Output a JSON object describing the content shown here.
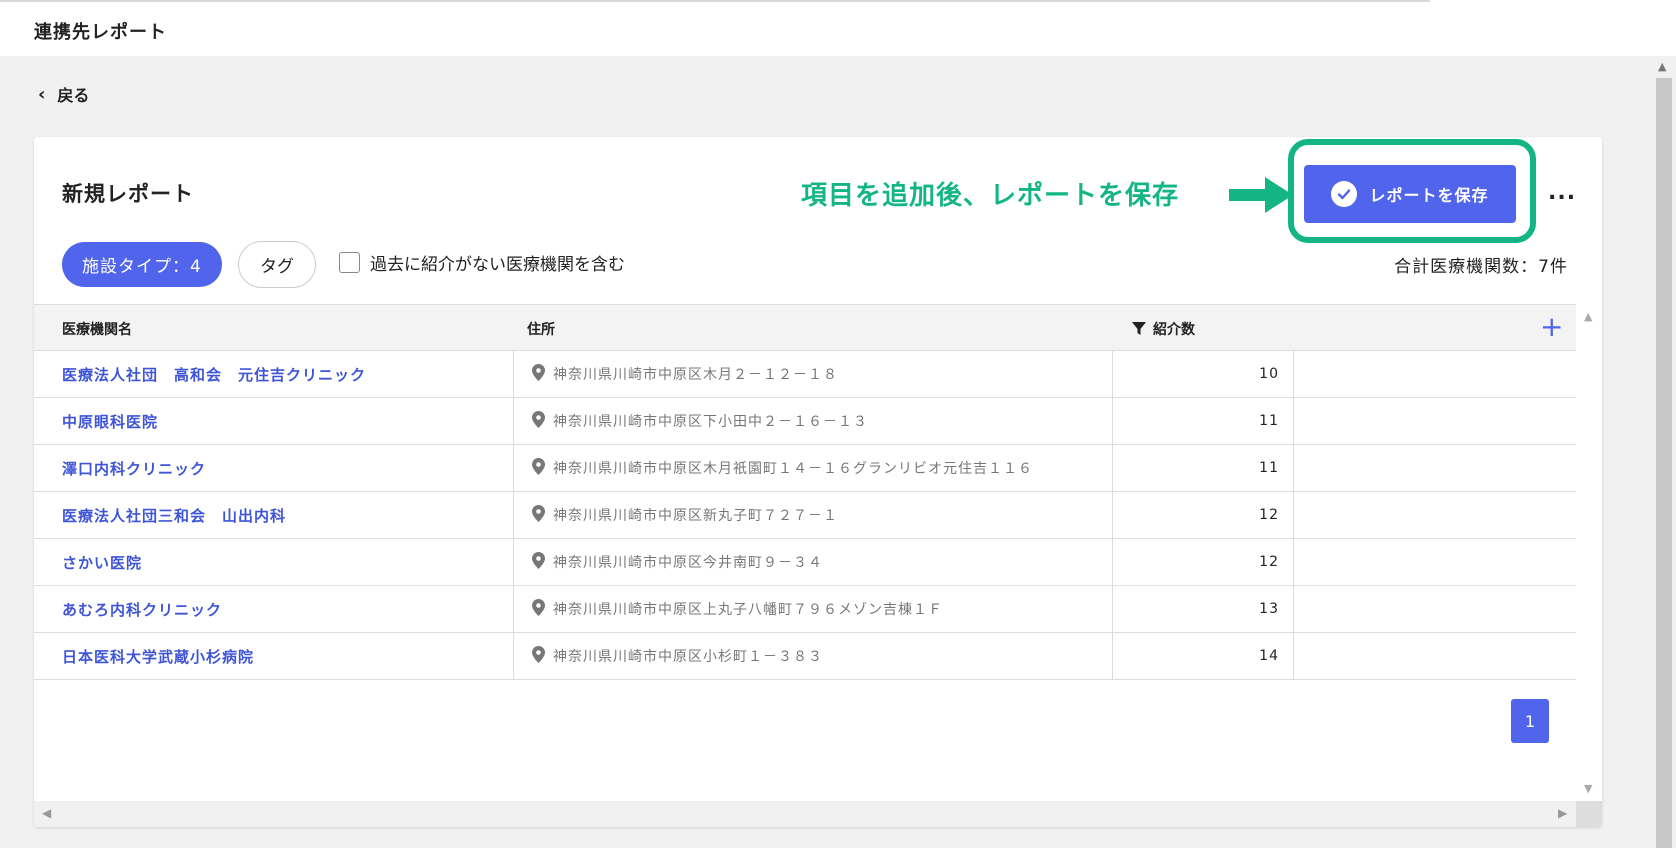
{
  "header": {
    "title": "連携先レポート"
  },
  "nav": {
    "back_label": "戻る"
  },
  "report": {
    "title": "新規レポート",
    "annotation": "項目を追加後、レポートを保存",
    "save_button": "レポートを保存",
    "more_label": "...",
    "filters": {
      "facility_type_chip": "施設タイプ：4",
      "tag_chip": "タグ",
      "include_checkbox_label": "過去に紹介がない医療機関を含む",
      "include_checked": false
    },
    "total_label": "合計医療機関数：7件"
  },
  "table": {
    "columns": {
      "name": "医療機関名",
      "address": "住所",
      "referrals": "紹介数",
      "add": "+"
    },
    "rows": [
      {
        "name": "医療法人社団　高和会　元住吉クリニック",
        "address": "神奈川県川崎市中原区木月２－１２－１８",
        "referrals": "10"
      },
      {
        "name": "中原眼科医院",
        "address": "神奈川県川崎市中原区下小田中２－１６－１３",
        "referrals": "11"
      },
      {
        "name": "澤口内科クリニック",
        "address": "神奈川県川崎市中原区木月祇園町１４－１６グランリビオ元住吉１１６",
        "referrals": "11"
      },
      {
        "name": "医療法人社団三和会　山出内科",
        "address": "神奈川県川崎市中原区新丸子町７２７－１",
        "referrals": "12"
      },
      {
        "name": "さかい医院",
        "address": "神奈川県川崎市中原区今井南町９－３４",
        "referrals": "12"
      },
      {
        "name": "あむろ内科クリニック",
        "address": "神奈川県川崎市中原区上丸子八幡町７９６メゾン吉棟１Ｆ",
        "referrals": "13"
      },
      {
        "name": "日本医科大学武蔵小杉病院",
        "address": "神奈川県川崎市中原区小杉町１－３８３",
        "referrals": "14"
      }
    ]
  },
  "pagination": {
    "current_page": "1"
  },
  "colors": {
    "accent": "#5064ec",
    "annotation": "#13b584",
    "link": "#3f55d8"
  },
  "icons": [
    "chevron-left-icon",
    "check-circle-icon",
    "more-icon",
    "filter-icon",
    "plus-icon",
    "map-pin-icon",
    "arrow-right-icon"
  ]
}
